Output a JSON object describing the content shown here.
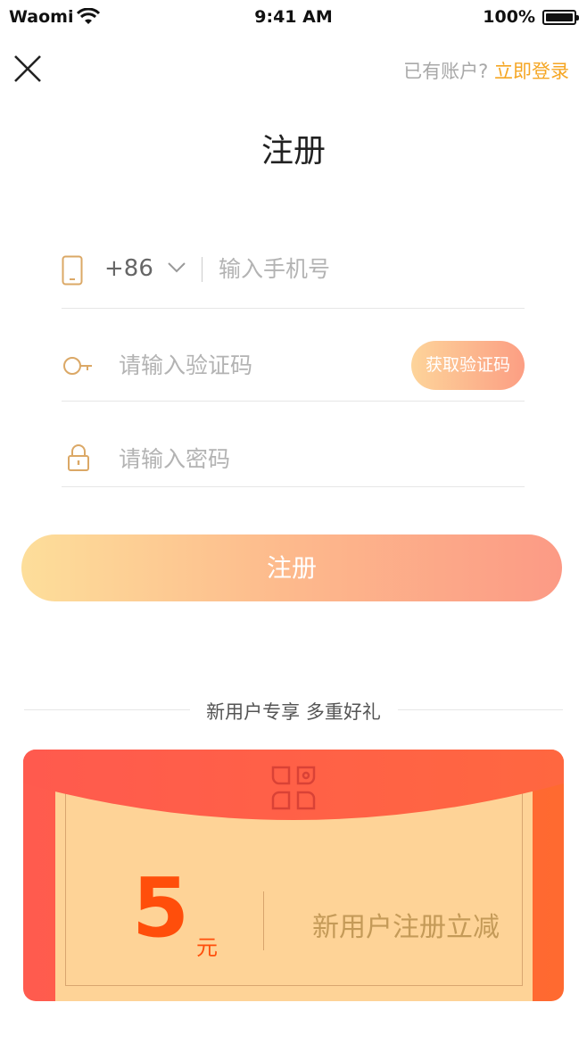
{
  "status_bar": {
    "carrier": "Waomi",
    "time": "9:41 AM",
    "battery": "100%"
  },
  "header": {
    "has_account_text": "已有账户?",
    "login_link": "立即登录"
  },
  "page_title": "注册",
  "form": {
    "country_code": "+86",
    "phone_placeholder": "输入手机号",
    "code_placeholder": "请输入验证码",
    "get_code_label": "获取验证码",
    "password_placeholder": "请输入密码",
    "submit_label": "注册"
  },
  "promo": {
    "title": "新用户专享 多重好礼",
    "amount": "5",
    "unit": "元",
    "description": "新用户注册立减"
  },
  "colors": {
    "accent": "#f5a623",
    "icon": "#dba866",
    "red": "#ff5b4f"
  },
  "icons": [
    "wifi-icon",
    "battery-icon",
    "close-icon",
    "phone-icon",
    "chevron-down-icon",
    "key-icon",
    "lock-icon",
    "gift-logo-icon"
  ]
}
